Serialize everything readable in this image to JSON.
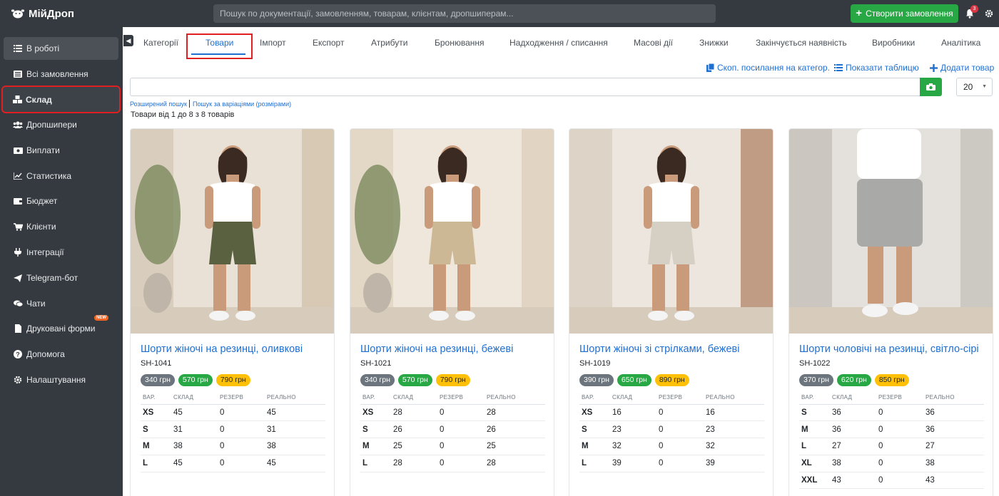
{
  "app": {
    "name": "МійДроп"
  },
  "top_search": {
    "placeholder": "Пошук по документації, замовленням, товарам, клієнтам, дропшиперам..."
  },
  "top_actions": {
    "create_order": "Створити замовлення",
    "notifications_count": "3"
  },
  "sidebar": {
    "items": [
      {
        "label": "В роботі",
        "icon": "list-icon"
      },
      {
        "label": "Всі замовлення",
        "icon": "list-alt-icon"
      },
      {
        "label": "Склад",
        "icon": "boxes-icon"
      },
      {
        "label": "Дропшипери",
        "icon": "users-icon"
      },
      {
        "label": "Виплати",
        "icon": "money-icon"
      },
      {
        "label": "Статистика",
        "icon": "chart-icon"
      },
      {
        "label": "Бюджет",
        "icon": "wallet-icon"
      },
      {
        "label": "Клієнти",
        "icon": "cart-icon"
      },
      {
        "label": "Інтеграції",
        "icon": "plug-icon"
      },
      {
        "label": "Telegram-бот",
        "icon": "paper-plane-icon"
      },
      {
        "label": "Чати",
        "icon": "comments-icon"
      },
      {
        "label": "Друковані форми",
        "icon": "file-icon",
        "badge": "NEW"
      },
      {
        "label": "Допомога",
        "icon": "question-icon"
      },
      {
        "label": "Налаштування",
        "icon": "cog-icon"
      }
    ]
  },
  "tabs": [
    "Категорії",
    "Товари",
    "Імпорт",
    "Експорт",
    "Атрибути",
    "Бронювання",
    "Надходження / списання",
    "Масові дії",
    "Знижки",
    "Закінчується наявність",
    "Виробники",
    "Аналітика"
  ],
  "toolbar": {
    "copy_link": "Скоп. посилання на категор.",
    "show_table": "Показати таблицю",
    "add_product": "Додати товар"
  },
  "search": {
    "value": "",
    "per_page": "20"
  },
  "links": {
    "advanced": "Розширений пошук",
    "by_variations": "Пошук за варіаціями (розмірами)"
  },
  "result_count": "Товари від 1 до 8 з 8 товарів",
  "table_headers": [
    "ВАР.",
    "СКЛАД",
    "РЕЗЕРВ",
    "РЕАЛЬНО"
  ],
  "colors": {
    "accent": "#1f6fd1",
    "success": "#28a745",
    "warning": "#ffc107",
    "sidebar": "#343a40"
  },
  "products": [
    {
      "title": "Шорти жіночі на резинці, оливкові",
      "sku": "SH-1041",
      "prices": [
        "340 грн",
        "570 грн",
        "790 грн"
      ],
      "variants": [
        {
          "size": "XS",
          "stock": "45",
          "reserve": "0",
          "real": "45"
        },
        {
          "size": "S",
          "stock": "31",
          "reserve": "0",
          "real": "31"
        },
        {
          "size": "M",
          "stock": "38",
          "reserve": "0",
          "real": "38"
        },
        {
          "size": "L",
          "stock": "45",
          "reserve": "0",
          "real": "45"
        }
      ]
    },
    {
      "title": "Шорти жіночі на резинці, бежеві",
      "sku": "SH-1021",
      "prices": [
        "340 грн",
        "570 грн",
        "790 грн"
      ],
      "variants": [
        {
          "size": "XS",
          "stock": "28",
          "reserve": "0",
          "real": "28"
        },
        {
          "size": "S",
          "stock": "26",
          "reserve": "0",
          "real": "26"
        },
        {
          "size": "M",
          "stock": "25",
          "reserve": "0",
          "real": "25"
        },
        {
          "size": "L",
          "stock": "28",
          "reserve": "0",
          "real": "28"
        }
      ]
    },
    {
      "title": "Шорти жіночі зі стрілками, бежеві",
      "sku": "SH-1019",
      "prices": [
        "390 грн",
        "650 грн",
        "890 грн"
      ],
      "variants": [
        {
          "size": "XS",
          "stock": "16",
          "reserve": "0",
          "real": "16"
        },
        {
          "size": "S",
          "stock": "23",
          "reserve": "0",
          "real": "23"
        },
        {
          "size": "M",
          "stock": "32",
          "reserve": "0",
          "real": "32"
        },
        {
          "size": "L",
          "stock": "39",
          "reserve": "0",
          "real": "39"
        }
      ]
    },
    {
      "title": "Шорти чоловічі на резинці, світло-сірі",
      "sku": "SH-1022",
      "prices": [
        "370 грн",
        "620 грн",
        "850 грн"
      ],
      "variants": [
        {
          "size": "S",
          "stock": "36",
          "reserve": "0",
          "real": "36"
        },
        {
          "size": "M",
          "stock": "36",
          "reserve": "0",
          "real": "36"
        },
        {
          "size": "L",
          "stock": "27",
          "reserve": "0",
          "real": "27"
        },
        {
          "size": "XL",
          "stock": "38",
          "reserve": "0",
          "real": "38"
        },
        {
          "size": "XXL",
          "stock": "43",
          "reserve": "0",
          "real": "43"
        }
      ]
    }
  ]
}
